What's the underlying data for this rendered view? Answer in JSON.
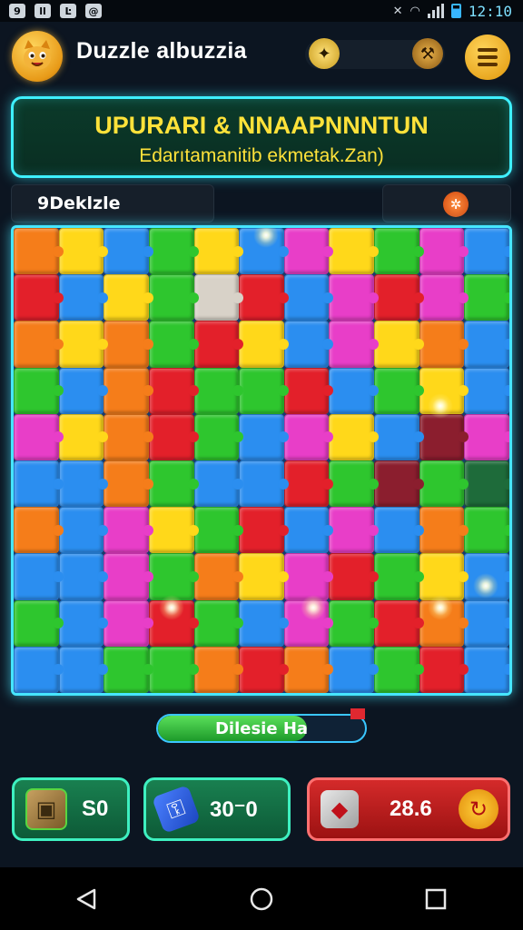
{
  "status_bar": {
    "left_icons": [
      "9",
      "ll",
      "Ŀ",
      "@"
    ],
    "time": "12:10"
  },
  "header": {
    "title": "Duzzle albuzzia",
    "left_icon": "cat-mascot-icon",
    "right_icons": [
      "lightbulb-icon",
      "hammer-icon",
      "menu-icon"
    ]
  },
  "banner": {
    "title": "UPURARI & NNAAPNNNTUN",
    "subtitle": "Edarıtamanitib ekmetak.Zan)"
  },
  "info_bar": {
    "label": "9Deklzle",
    "icon": "hint-icon"
  },
  "puzzle": {
    "columns": 11,
    "rows": 10,
    "colors": {
      "o": "#f57d1a",
      "y": "#ffd81a",
      "g": "#2ec62e",
      "b": "#2b8ef0",
      "p": "#e83ec8",
      "r": "#e3202a",
      "w": "#d8d2c8",
      "m": "#8b1e2e",
      "d": "#1e6b3a"
    },
    "layout": [
      "oybgybpygpb",
      "rbygwrbprpg",
      "oyogrybpyob",
      "gborggrbgyb",
      "pyorgbpybmp",
      "bbogbbrgmgd",
      "obpygrbpbog",
      "bbpgoyprgyb",
      "gbprgbpgrob",
      "bbggorobgrb"
    ]
  },
  "progress": {
    "label": "Dilesie Ha",
    "fraction": 0.72
  },
  "bottom_cards": [
    {
      "icon": "crate-icon",
      "value": "S0"
    },
    {
      "icon": "key-icon",
      "value": "30⁻0"
    },
    {
      "icon": "gem-icon",
      "value": "28.6",
      "action_icon": "refresh-bolt-icon"
    }
  ],
  "nav": [
    "back-icon",
    "home-icon",
    "recents-icon"
  ]
}
